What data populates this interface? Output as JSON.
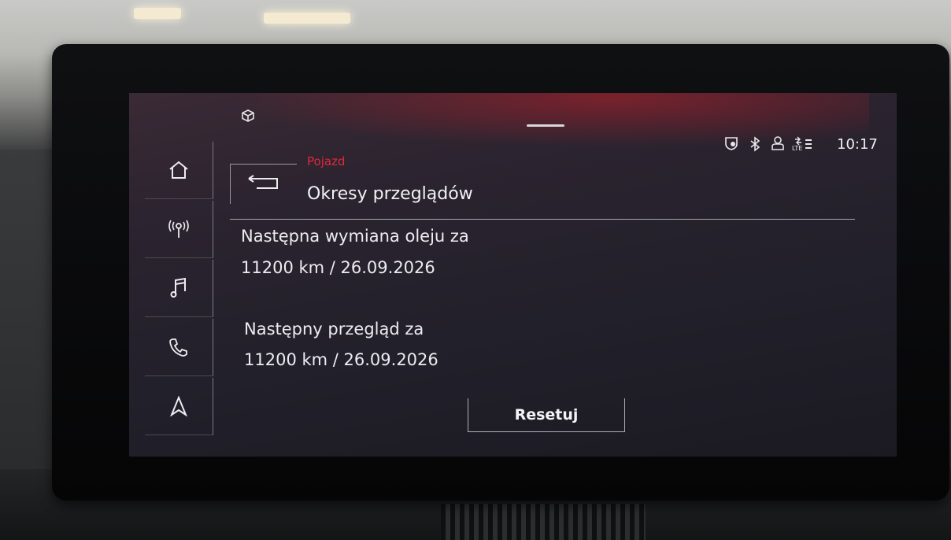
{
  "status_bar": {
    "time": "10:17",
    "icons": [
      "car-app-icon",
      "navigation-shield-icon",
      "bluetooth-icon",
      "user-profile-icon",
      "lte-signal-icon"
    ]
  },
  "nav": {
    "items": [
      {
        "icon": "home-icon"
      },
      {
        "icon": "radio-icon"
      },
      {
        "icon": "music-note-icon"
      },
      {
        "icon": "phone-icon"
      },
      {
        "icon": "navigation-arrow-icon"
      }
    ]
  },
  "header": {
    "category": "Pojazd",
    "title": "Okresy przeglądów",
    "category_color": "#e0283a"
  },
  "service": {
    "oil_label": "Następna wymiana oleju za",
    "oil_value": "11200 km / 26.09.2026",
    "inspection_label": "Następny przegląd za",
    "inspection_value": "11200 km / 26.09.2026"
  },
  "actions": {
    "reset_label": "Resetuj"
  }
}
